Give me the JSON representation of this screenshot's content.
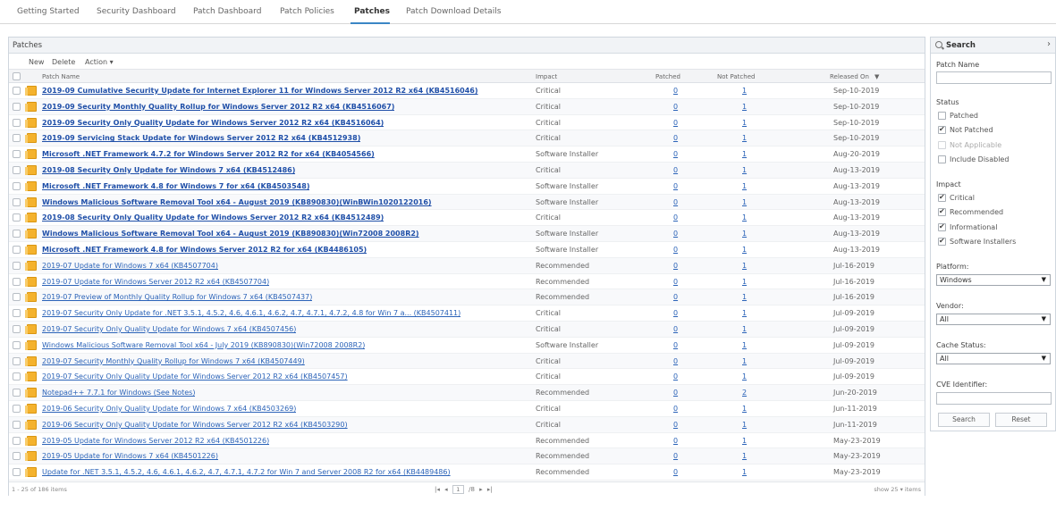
{
  "tabs": [
    {
      "label": "Getting Started"
    },
    {
      "label": "Security Dashboard"
    },
    {
      "label": "Patch Dashboard"
    },
    {
      "label": "Patch Policies"
    },
    {
      "label": "Patches"
    },
    {
      "label": "Patch Download Details"
    }
  ],
  "active_tab": "Patches",
  "grid": {
    "title": "Patches",
    "toolbar": {
      "new": "New",
      "delete": "Delete",
      "action": "Action ▾"
    },
    "columns": {
      "patch_name": "Patch Name",
      "impact": "Impact",
      "patched": "Patched",
      "not_patched": "Not Patched",
      "released_on": "Released On"
    },
    "sort_indicator": "▼",
    "rows": [
      {
        "name": "2019-09 Cumulative Security Update for Internet Explorer 11 for Windows Server 2012 R2 x64 (KB4516046)",
        "bold": true,
        "impact": "Critical",
        "patched": "0",
        "not_patched": "1",
        "released": "Sep-10-2019"
      },
      {
        "name": "2019-09 Security Monthly Quality Rollup for Windows Server 2012 R2 x64 (KB4516067)",
        "bold": true,
        "impact": "Critical",
        "patched": "0",
        "not_patched": "1",
        "released": "Sep-10-2019"
      },
      {
        "name": "2019-09 Security Only Quality Update for Windows Server 2012 R2 x64 (KB4516064)",
        "bold": true,
        "impact": "Critical",
        "patched": "0",
        "not_patched": "1",
        "released": "Sep-10-2019"
      },
      {
        "name": "2019-09 Servicing Stack Update for Windows Server 2012 R2 x64 (KB4512938)",
        "bold": true,
        "impact": "Critical",
        "patched": "0",
        "not_patched": "1",
        "released": "Sep-10-2019"
      },
      {
        "name": "Microsoft .NET Framework 4.7.2 for Windows Server 2012 R2 for x64 (KB4054566)",
        "bold": true,
        "impact": "Software Installer",
        "patched": "0",
        "not_patched": "1",
        "released": "Aug-20-2019"
      },
      {
        "name": "2019-08 Security Only Update for Windows 7 x64 (KB4512486)",
        "bold": true,
        "impact": "Critical",
        "patched": "0",
        "not_patched": "1",
        "released": "Aug-13-2019"
      },
      {
        "name": "Microsoft .NET Framework 4.8 for Windows 7 for x64 (KB4503548)",
        "bold": true,
        "impact": "Software Installer",
        "patched": "0",
        "not_patched": "1",
        "released": "Aug-13-2019"
      },
      {
        "name": "Windows Malicious Software Removal Tool x64 - August 2019 (KB890830)(WinBWin1020122016)",
        "bold": true,
        "impact": "Software Installer",
        "patched": "0",
        "not_patched": "1",
        "released": "Aug-13-2019"
      },
      {
        "name": "2019-08 Security Only Quality Update for Windows Server 2012 R2 x64 (KB4512489)",
        "bold": true,
        "impact": "Critical",
        "patched": "0",
        "not_patched": "1",
        "released": "Aug-13-2019"
      },
      {
        "name": "Windows Malicious Software Removal Tool x64 - August 2019 (KB890830)(Win72008 2008R2)",
        "bold": true,
        "impact": "Software Installer",
        "patched": "0",
        "not_patched": "1",
        "released": "Aug-13-2019"
      },
      {
        "name": "Microsoft .NET Framework 4.8 for Windows Server 2012 R2 for x64 (KB4486105)",
        "bold": true,
        "impact": "Software Installer",
        "patched": "0",
        "not_patched": "1",
        "released": "Aug-13-2019"
      },
      {
        "name": "2019-07 Update for Windows 7 x64 (KB4507704)",
        "bold": false,
        "impact": "Recommended",
        "patched": "0",
        "not_patched": "1",
        "released": "Jul-16-2019"
      },
      {
        "name": "2019-07 Update for Windows Server 2012 R2 x64 (KB4507704)",
        "bold": false,
        "impact": "Recommended",
        "patched": "0",
        "not_patched": "1",
        "released": "Jul-16-2019"
      },
      {
        "name": "2019-07 Preview of Monthly Quality Rollup for Windows 7 x64 (KB4507437)",
        "bold": false,
        "impact": "Recommended",
        "patched": "0",
        "not_patched": "1",
        "released": "Jul-16-2019"
      },
      {
        "name": "2019-07 Security Only Update for .NET 3.5.1, 4.5.2, 4.6, 4.6.1, 4.6.2, 4.7, 4.7.1, 4.7.2, 4.8 for Win 7 a... (KB4507411)",
        "bold": false,
        "impact": "Critical",
        "patched": "0",
        "not_patched": "1",
        "released": "Jul-09-2019"
      },
      {
        "name": "2019-07 Security Only Quality Update for Windows 7 x64 (KB4507456)",
        "bold": false,
        "impact": "Critical",
        "patched": "0",
        "not_patched": "1",
        "released": "Jul-09-2019"
      },
      {
        "name": "Windows Malicious Software Removal Tool x64 - July 2019 (KB890830)(Win72008 2008R2)",
        "bold": false,
        "impact": "Software Installer",
        "patched": "0",
        "not_patched": "1",
        "released": "Jul-09-2019"
      },
      {
        "name": "2019-07 Security Monthly Quality Rollup for Windows 7 x64 (KB4507449)",
        "bold": false,
        "impact": "Critical",
        "patched": "0",
        "not_patched": "1",
        "released": "Jul-09-2019"
      },
      {
        "name": "2019-07 Security Only Quality Update for Windows Server 2012 R2 x64 (KB4507457)",
        "bold": false,
        "impact": "Critical",
        "patched": "0",
        "not_patched": "1",
        "released": "Jul-09-2019"
      },
      {
        "name": "Notepad++ 7.7.1 for Windows (See Notes)",
        "bold": false,
        "impact": "Recommended",
        "patched": "0",
        "not_patched": "2",
        "released": "Jun-20-2019"
      },
      {
        "name": "2019-06 Security Only Quality Update for Windows 7 x64 (KB4503269)",
        "bold": false,
        "impact": "Critical",
        "patched": "0",
        "not_patched": "1",
        "released": "Jun-11-2019"
      },
      {
        "name": "2019-06 Security Only Quality Update for Windows Server 2012 R2 x64 (KB4503290)",
        "bold": false,
        "impact": "Critical",
        "patched": "0",
        "not_patched": "1",
        "released": "Jun-11-2019"
      },
      {
        "name": "2019-05 Update for Windows Server 2012 R2 x64 (KB4501226)",
        "bold": false,
        "impact": "Recommended",
        "patched": "0",
        "not_patched": "1",
        "released": "May-23-2019"
      },
      {
        "name": "2019-05 Update for Windows 7 x64 (KB4501226)",
        "bold": false,
        "impact": "Recommended",
        "patched": "0",
        "not_patched": "1",
        "released": "May-23-2019"
      },
      {
        "name": "Update for .NET 3.5.1, 4.5.2, 4.6, 4.6.1, 4.6.2, 4.7, 4.7.1, 4.7.2 for Win 7 and Server 2008 R2 for x64 (KB4489486)",
        "bold": false,
        "impact": "Recommended",
        "patched": "0",
        "not_patched": "1",
        "released": "May-23-2019"
      }
    ],
    "footer": {
      "count": "1 - 25 of 186 items",
      "first": "|◂",
      "prev": "◂",
      "page": "1",
      "of_pages": "/8",
      "next": "▸",
      "last": "▸|",
      "show": "show 25 ▾ items"
    }
  },
  "search": {
    "title": "Search",
    "chevron": "›",
    "patch_name_label": "Patch Name",
    "patch_name_value": "",
    "status_label": "Status",
    "status_options": [
      {
        "label": "Patched",
        "checked": false,
        "disabled": false
      },
      {
        "label": "Not Patched",
        "checked": true,
        "disabled": false
      },
      {
        "label": "Not Applicable",
        "checked": false,
        "disabled": true
      },
      {
        "label": "Include Disabled",
        "checked": false,
        "disabled": false
      }
    ],
    "impact_label": "Impact",
    "impact_options": [
      {
        "label": "Critical",
        "checked": true
      },
      {
        "label": "Recommended",
        "checked": true
      },
      {
        "label": "Informational",
        "checked": true
      },
      {
        "label": "Software Installers",
        "checked": true
      }
    ],
    "platform_label": "Platform:",
    "platform_value": "Windows",
    "vendor_label": "Vendor:",
    "vendor_value": "All",
    "cache_label": "Cache Status:",
    "cache_value": "All",
    "cve_label": "CVE Identifier:",
    "cve_value": "",
    "search_button": "Search",
    "reset_button": "Reset",
    "select_arrow": "▼"
  }
}
